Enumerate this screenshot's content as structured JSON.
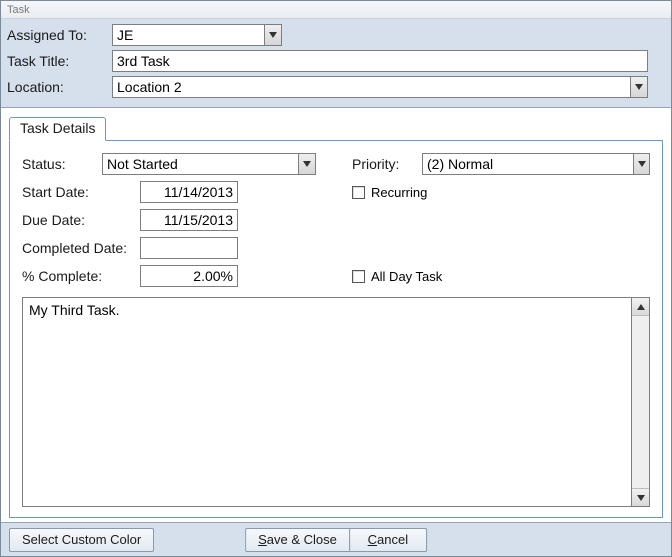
{
  "window": {
    "title": "Task"
  },
  "header": {
    "assigned_to_label": "Assigned To:",
    "assigned_to_value": "JE",
    "task_title_label": "Task Title:",
    "task_title_value": "3rd Task",
    "location_label": "Location:",
    "location_value": "Location 2"
  },
  "tab": {
    "details_label": "Task Details"
  },
  "details": {
    "status_label": "Status:",
    "status_value": "Not Started",
    "priority_label": "Priority:",
    "priority_value": "(2) Normal",
    "start_date_label": "Start Date:",
    "start_date_value": "11/14/2013",
    "recurring_label": "Recurring",
    "recurring_checked": false,
    "due_date_label": "Due Date:",
    "due_date_value": "11/15/2013",
    "completed_date_label": "Completed Date:",
    "completed_date_value": "",
    "pct_complete_label": "% Complete:",
    "pct_complete_value": "2.00%",
    "all_day_label": "All Day Task",
    "all_day_checked": false,
    "notes_value": "My Third Task."
  },
  "footer": {
    "custom_color_label": "Select Custom Color",
    "save_close_prefix": "S",
    "save_close_rest": "ave & Close",
    "cancel_prefix": "C",
    "cancel_rest": "ancel"
  }
}
